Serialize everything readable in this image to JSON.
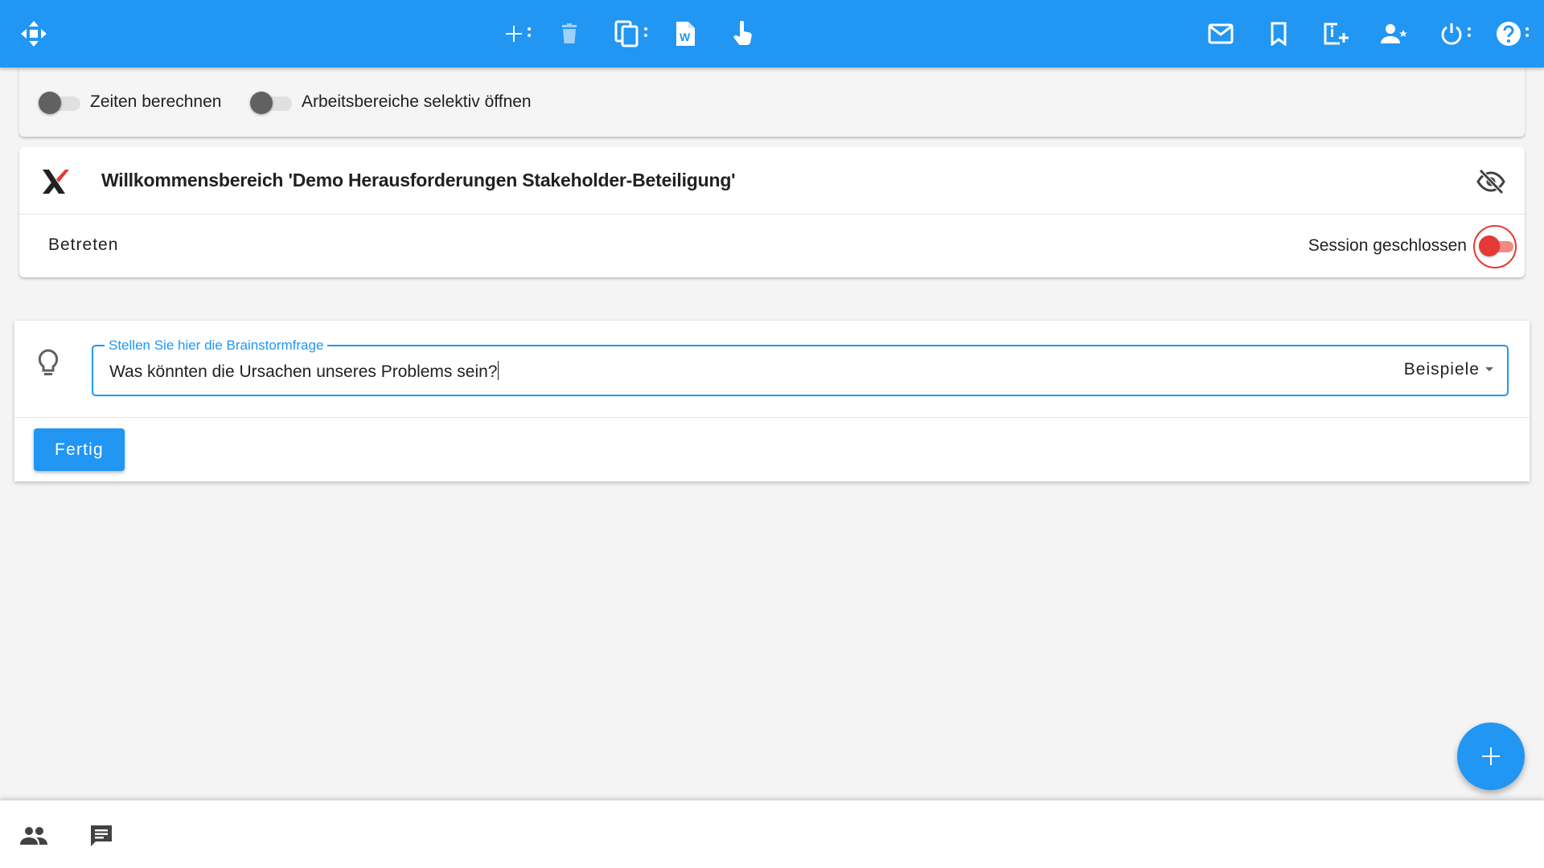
{
  "toolbar": {
    "left_icon": "move-arrows-icon",
    "center_icons": [
      "add-icon",
      "delete-icon",
      "copy-icon",
      "word-document-icon",
      "pointer-hand-icon"
    ],
    "right_icons": [
      "mail-icon",
      "bookmark-icon",
      "add-page-icon",
      "person-star-icon",
      "power-icon",
      "help-icon"
    ]
  },
  "options": {
    "calc_times_label": "Zeiten berechnen",
    "calc_times_on": false,
    "open_selective_label": "Arbeitsbereiche selektiv öffnen",
    "open_selective_on": false
  },
  "welcome": {
    "title": "Willkommensbereich 'Demo Herausforderungen Stakeholder-Beteiligung'",
    "enter_label": "Betreten",
    "session_label": "Session geschlossen",
    "session_on": false
  },
  "brainstorm": {
    "legend": "Stellen Sie hier die Brainstormfrage",
    "question": "Was könnten die Ursachen unseres Problems sein?",
    "examples_label": "Beispiele",
    "done_label": "Fertig"
  },
  "colors": {
    "primary": "#2196f3",
    "danger": "#e53935",
    "background": "#f4f4f4"
  },
  "bottom_bar": {
    "icons": [
      "people-icon",
      "chat-icon"
    ]
  }
}
